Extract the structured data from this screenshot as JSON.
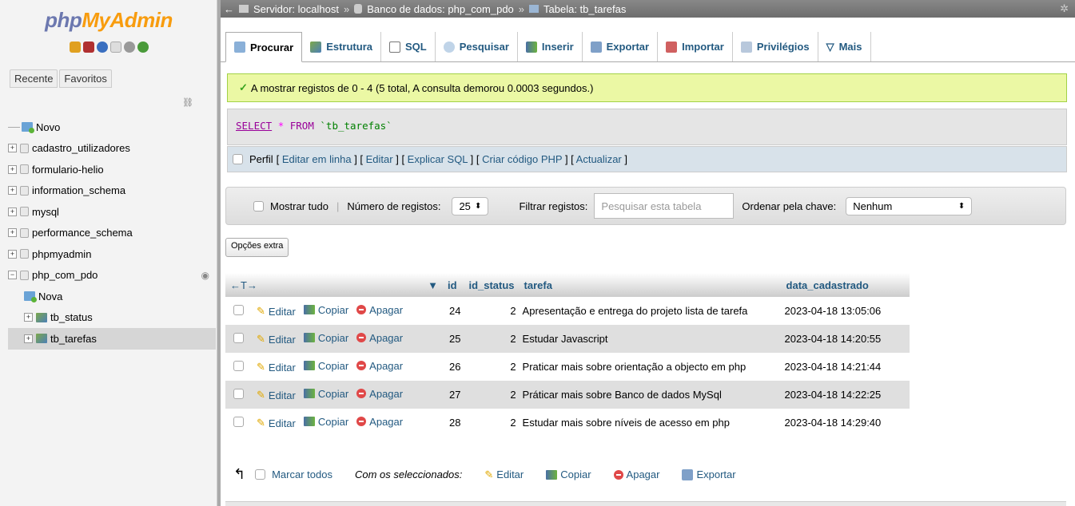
{
  "nav": {
    "logo_php": "php",
    "logo_my": "MyAdmin",
    "tabs": [
      "Recente",
      "Favoritos"
    ],
    "new_label": "Novo",
    "databases": [
      "cadastro_utilizadores",
      "formulario-helio",
      "information_schema",
      "mysql",
      "performance_schema",
      "phpmyadmin",
      "php_com_pdo"
    ],
    "sub_new": "Nova",
    "tables": [
      "tb_status",
      "tb_tarefas"
    ]
  },
  "breadcrumb": {
    "server": "Servidor: localhost",
    "db": "Banco de dados: php_com_pdo",
    "table": "Tabela: tb_tarefas",
    "sep": "»",
    "back": "←"
  },
  "tabs": [
    "Procurar",
    "Estrutura",
    "SQL",
    "Pesquisar",
    "Inserir",
    "Exportar",
    "Importar",
    "Privilégios",
    "Mais"
  ],
  "success_msg": "A mostrar registos de 0 - 4 (5 total, A consulta demorou 0.0003 segundos.)",
  "sql": {
    "select": "SELECT",
    "star": "*",
    "from": "FROM",
    "table": "`tb_tarefas`"
  },
  "profile": {
    "label": "Perfil",
    "links": [
      "Editar em linha",
      "Editar",
      "Explicar SQL",
      "Criar código PHP",
      "Actualizar"
    ]
  },
  "navbar": {
    "show_all": "Mostrar tudo",
    "num_rows_label": "Número de registos:",
    "num_rows_value": "25",
    "filter_label": "Filtrar registos:",
    "filter_placeholder": "Pesquisar esta tabela",
    "sort_label": "Ordenar pela chave:",
    "sort_value": "Nenhum"
  },
  "extra_options": "Opções extra",
  "table": {
    "arrows": "←T→",
    "sort_icon": "▼",
    "columns": [
      "id",
      "id_status",
      "tarefa",
      "data_cadastrado"
    ],
    "actions": [
      "Editar",
      "Copiar",
      "Apagar"
    ],
    "rows": [
      {
        "id": "24",
        "id_status": "2",
        "tarefa": "Apresentação e entrega do projeto lista de tarefa",
        "data": "2023-04-18 13:05:06"
      },
      {
        "id": "25",
        "id_status": "2",
        "tarefa": "Estudar Javascript",
        "data": "2023-04-18 14:20:55"
      },
      {
        "id": "26",
        "id_status": "2",
        "tarefa": "Praticar mais sobre orientação a objecto em php",
        "data": "2023-04-18 14:21:44"
      },
      {
        "id": "27",
        "id_status": "2",
        "tarefa": "Práticar mais sobre Banco de dados MySql",
        "data": "2023-04-18 14:22:25"
      },
      {
        "id": "28",
        "id_status": "2",
        "tarefa": "Estudar mais sobre níveis de acesso em php",
        "data": "2023-04-18 14:29:40"
      }
    ]
  },
  "bottom": {
    "check_all": "Marcar todos",
    "with_selected": "Com os seleccionados:",
    "edit": "Editar",
    "copy": "Copiar",
    "delete": "Apagar",
    "export": "Exportar"
  }
}
